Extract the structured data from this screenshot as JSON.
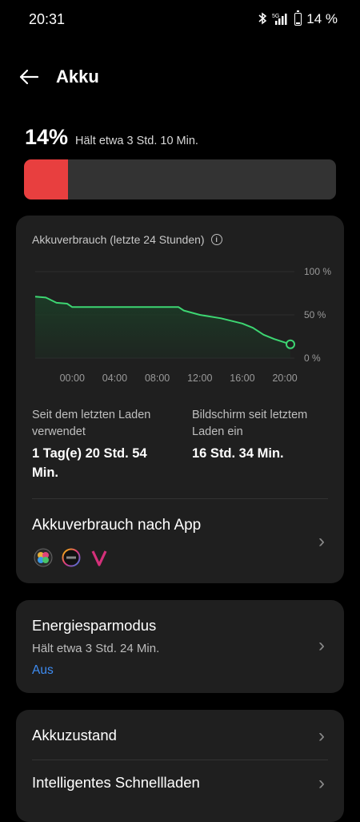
{
  "status_bar": {
    "time": "20:31",
    "battery": "14 %",
    "network": "5G"
  },
  "header": {
    "title": "Akku"
  },
  "battery": {
    "percent": "14%",
    "percent_value": 14,
    "estimate": "Hält etwa 3 Std. 10 Min.",
    "fill_color": "#e83f3f"
  },
  "usage": {
    "title": "Akkuverbrauch (letzte 24 Stunden)",
    "since_charge_label": "Seit dem letzten Laden verwendet",
    "since_charge_value": "1 Tag(e) 20 Std. 54 Min.",
    "screen_on_label": "Bildschirm seit letztem Laden ein",
    "screen_on_value": "16 Std. 34 Min.",
    "apps_title": "Akkuverbrauch nach App",
    "apps": [
      "photos-app-icon",
      "sport-app-icon",
      "viber-app-icon"
    ]
  },
  "chart_data": {
    "type": "area",
    "title": "Akkuverbrauch (letzte 24 Stunden)",
    "x": [
      "20:31",
      "21:30",
      "22:30",
      "23:30",
      "00:00",
      "02:00",
      "04:00",
      "06:00",
      "08:00",
      "10:00",
      "10:30",
      "12:00",
      "14:00",
      "16:00",
      "17:00",
      "18:00",
      "19:00",
      "20:31"
    ],
    "values": [
      71,
      70,
      64,
      63,
      59,
      59,
      59,
      59,
      59,
      59,
      55,
      50,
      46,
      40,
      35,
      27,
      22,
      16
    ],
    "y_ticks": [
      "100 %",
      "50 %",
      "0 %"
    ],
    "x_ticks": [
      "00:00",
      "04:00",
      "08:00",
      "12:00",
      "16:00",
      "20:00"
    ],
    "ylim": [
      0,
      100
    ],
    "line_color": "#3dd672",
    "area_color": "#1c3a26"
  },
  "energy_saver": {
    "title": "Energiesparmodus",
    "subtitle": "Hält etwa 3 Std. 24 Min.",
    "state": "Aus"
  },
  "health": {
    "title": "Akkuzustand",
    "fast_charge": "Intelligentes Schnellladen"
  }
}
